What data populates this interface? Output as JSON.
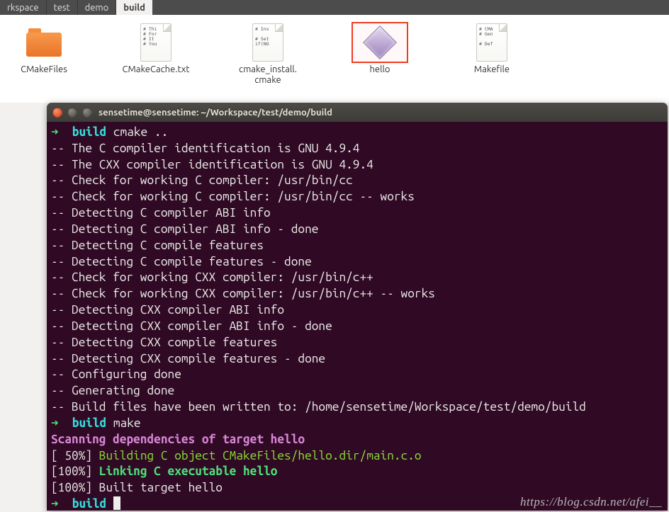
{
  "breadcrumb": {
    "items": [
      {
        "label": "rkspace"
      },
      {
        "label": "test"
      },
      {
        "label": "demo"
      },
      {
        "label": "build"
      }
    ],
    "active_index": 3
  },
  "files": {
    "items": [
      {
        "name": "CMakeFiles",
        "kind": "folder",
        "preview": ""
      },
      {
        "name": "CMakeCache.txt",
        "kind": "txt",
        "preview": "# Thi\n# For\n# It\n# You"
      },
      {
        "name": "cmake_install.\ncmake",
        "kind": "txt",
        "preview": "# Ins\n\n# Set\nif(NO"
      },
      {
        "name": "hello",
        "kind": "exec",
        "preview": ""
      },
      {
        "name": "Makefile",
        "kind": "txt",
        "preview": "# CMA\n# Gen\n\n# Def"
      }
    ],
    "selected_index": 3
  },
  "terminal": {
    "title": "sensetime@sensetime: ~/Workspace/test/demo/build",
    "prompt_arrow": "➜",
    "prompt_dir": "build",
    "cmd1": "cmake ..",
    "lines": [
      "-- The C compiler identification is GNU 4.9.4",
      "-- The CXX compiler identification is GNU 4.9.4",
      "-- Check for working C compiler: /usr/bin/cc",
      "-- Check for working C compiler: /usr/bin/cc -- works",
      "-- Detecting C compiler ABI info",
      "-- Detecting C compiler ABI info - done",
      "-- Detecting C compile features",
      "-- Detecting C compile features - done",
      "-- Check for working CXX compiler: /usr/bin/c++",
      "-- Check for working CXX compiler: /usr/bin/c++ -- works",
      "-- Detecting CXX compiler ABI info",
      "-- Detecting CXX compiler ABI info - done",
      "-- Detecting CXX compile features",
      "-- Detecting CXX compile features - done",
      "-- Configuring done",
      "-- Generating done",
      "-- Build files have been written to: /home/sensetime/Workspace/test/demo/build"
    ],
    "cmd2": "make",
    "scan": "Scanning dependencies of target hello",
    "p50_label": "[ 50%]",
    "p50_msg": "Building C object CMakeFiles/hello.dir/main.c.o",
    "p100a_label": "[100%]",
    "p100a_msg": "Linking C executable hello",
    "p100b_label": "[100%]",
    "p100b_msg": "Built target hello"
  },
  "watermark": "https://blog.csdn.net/afei__"
}
